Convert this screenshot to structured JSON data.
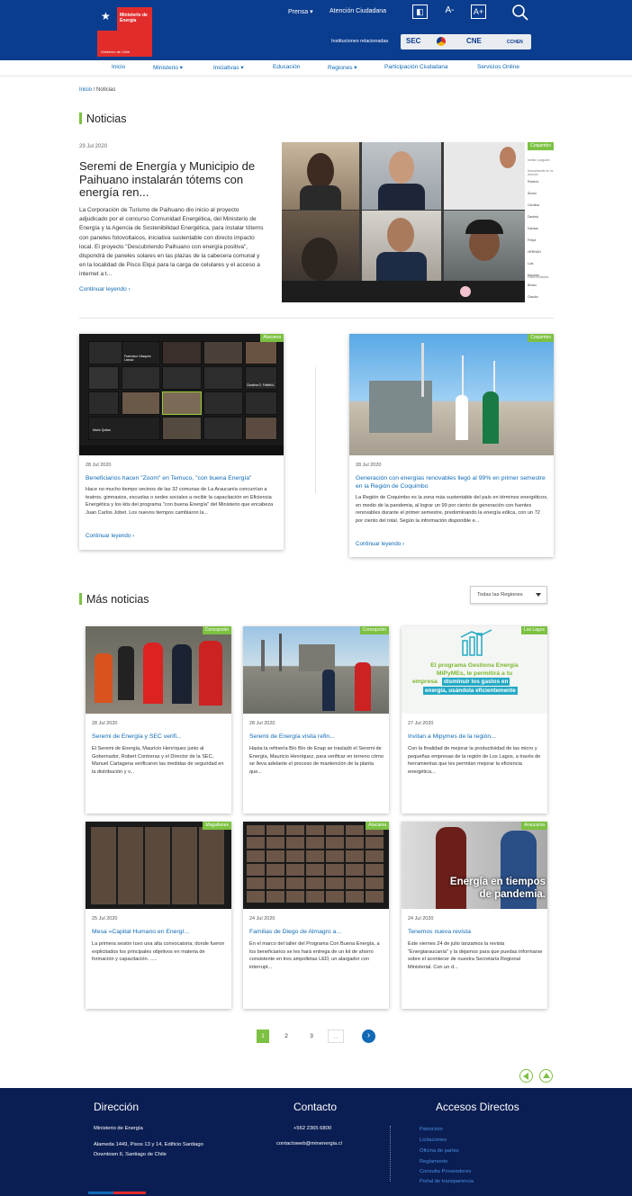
{
  "header": {
    "logo": {
      "line1": "Ministerio de Energía",
      "line2": "Gobierno de Chile"
    },
    "links": [
      "Prensa",
      "Atención Ciudadana"
    ],
    "font_buttons": [
      "◧",
      "A-",
      "A+"
    ],
    "institutions_label": "Instituciones relacionadas",
    "institutions": [
      "SEC",
      "CNE",
      "CCHEN"
    ]
  },
  "nav": {
    "items": [
      "Inicio",
      "Ministerio",
      "Iniciativas",
      "Educación",
      "Regiones",
      "Participación Ciudadana",
      "Servicios Online"
    ]
  },
  "breadcrumb": {
    "home": "Inicio",
    "current": " / Noticias"
  },
  "noticias": {
    "heading": "Noticias"
  },
  "featured": {
    "date": "29 Jul 2020",
    "title": "Seremi de Energía y Municipio de Paihuano instalarán tótems con energía ren...",
    "text": "La Corporación de Turismo de Paihuano dio inicio al proyecto adjudicado por el concurso Comunidad Energética, del Ministerio de Energía y la Agencia de Sostenibilidad Energética, para instalar tótems con paneles fotovoltaicos, iniciativa sustentable con directo impacto local.   El proyecto \"Descubriendo Paihuano con energía positiva\", dispondrá de paneles solares en las plazas de la cabecera comunal y en la localidad de Pisco Elqui para la carga de celulares y el acceso a internet a t...",
    "more": "Continuar leyendo",
    "tag": "Coquimbo",
    "sidebar": {
      "search": "Invitar a alguien",
      "section": "Actualmente en la reunión",
      "people": [
        "Roberto",
        "Álvaro",
        "Carolina",
        "Daniela",
        "Damian",
        "Felipe",
        "HERNÁN",
        "Luis",
        "Mauricio"
      ],
      "other": "Otros invitados",
      "extra": [
        "Álvaro",
        "Claudio"
      ]
    }
  },
  "two_cards": [
    {
      "tag": "Atacama",
      "date": "28 Jul 2020",
      "title": "Beneficiarios hacen \"Zoom\" en Temuco, \"con buena Energía\"",
      "text": "Hace no mucho tiempo vecinos de las 32 comunas de La Araucanía concurrían a teatros, gimnasios, escuelas o sedes sociales a recibir la capacitación en Eficiencia Energética y los kits del programa \"con buena Energía\" del Ministerio que encabeza Juan Carlos Jobet. Los nuevos tiempos cambiaron la...",
      "more": "Continuar leyendo",
      "zoom_names": [
        "Francisco Vásquez Llanca",
        "Claudina G. Poffatti A.",
        "Mario Quilan"
      ]
    },
    {
      "tag": "Coquimbo",
      "date": "28 Jul 2020",
      "title": "Generación con energías renovables llegó al 99% en primer semestre en la Región de Coquimbo",
      "text": "La Región de Coquimbo es la zona más sustentable del país en términos energéticos, en medio de la pandemia, al lograr un 99 por ciento de generación con fuentes renovables durante el primer semestre, predominando la energía eólica, con un 72 por ciento del total. Según la información disponible e...",
      "more": "Continuar leyendo"
    }
  ],
  "mas_noticias": {
    "heading": "Más noticias",
    "filter": "Todas las Regiones",
    "cards": [
      {
        "tag": "Concepción",
        "date": "28 Jul 2020",
        "title": "Seremi de Energía y SEC verifi...",
        "text": "El Seremi de Energía, Mauricio Henríquez junto al Gobernador, Robert Contreras y el Director de la SEC, Manuel Cartagena verificaron las medidas de seguridad en la distribución y v..."
      },
      {
        "tag": "Concepción",
        "date": "28 Jul 2020",
        "title": "Seremi de Energía visita refin...",
        "text": "Hasta la refinería Bío Bío de Enap se trasladó el Seremi de Energía, Mauricio Henríquez, para verificar en terreno cómo se lleva adelante el proceso de mantención de la planta que..."
      },
      {
        "tag": "Los Lagos",
        "date": "27 Jul 2020",
        "title": "Invitan a Mipymes de la región...",
        "text": "Con la finalidad de mejorar la productividad de las micro y pequeñas empresas de la región de Los Lagos, a través de herramientas que les permitan mejorar la eficiencia energética...",
        "promo": {
          "l1": "El programa Gestiona Energía",
          "l2": "MiPyMEs, le permitirá a tu",
          "l3": "empresa",
          "h1": "disminuir los gastos en",
          "h2": "energía, usándola eficientemente"
        }
      },
      {
        "tag": "Magallanes",
        "date": "25 Jul 2020",
        "title": "Mesa «Capital Humano en Energí...",
        "text": "La primera sesión tuvo una alta convocatoria; donde fueron explicitados los principales objetivos en materia de formación y capacitación.         ....."
      },
      {
        "tag": "Atacama",
        "date": "24 Jul 2020",
        "title": "Familias de Diego de Almagro a...",
        "text": "En el marco del taller del Programa Con Buena Energía, a los beneficiarios se les hará entrega de un kit de ahorro consistente en tres ampolletas LED, un alargador con interrupt..."
      },
      {
        "tag": "Araucanía",
        "date": "24 Jul 2020",
        "title": "Tenemos nueva revista",
        "text": "Este viernes 24 de julio lanzamos la revista \"Energiaraucanía\" y la dejamos para que puedas informarse sobre el acontecer de nuestra Secretaría Regional  Ministerial. Con un d...",
        "overlay1": "Energía en tiempos",
        "overlay2": "de pandemia."
      }
    ]
  },
  "pagination": {
    "pages": [
      "1",
      "2",
      "3",
      "..."
    ]
  },
  "footer": {
    "direccion": {
      "heading": "Dirección",
      "name": "Ministerio de Energía",
      "address": "Alameda 1449, Pisos 13 y 14, Edificio Santiago Downtown II, Santiago de Chile"
    },
    "contacto": {
      "heading": "Contacto",
      "phone": "+562 2365 6800",
      "email": "contactoweb@minenergia.cl"
    },
    "accesos": {
      "heading": "Accesos Directos",
      "links": [
        "Patrocinio",
        "Licitaciones",
        "Oficina de partes",
        "Reglamento",
        "Consulta Proveedores",
        "Portal de transparencia"
      ]
    }
  },
  "colors": {
    "brand_blue": "#0b3d8f",
    "link": "#0f69b4",
    "accent_green": "#7cc142",
    "red": "#e22c2c",
    "footer": "#0b1e53"
  }
}
